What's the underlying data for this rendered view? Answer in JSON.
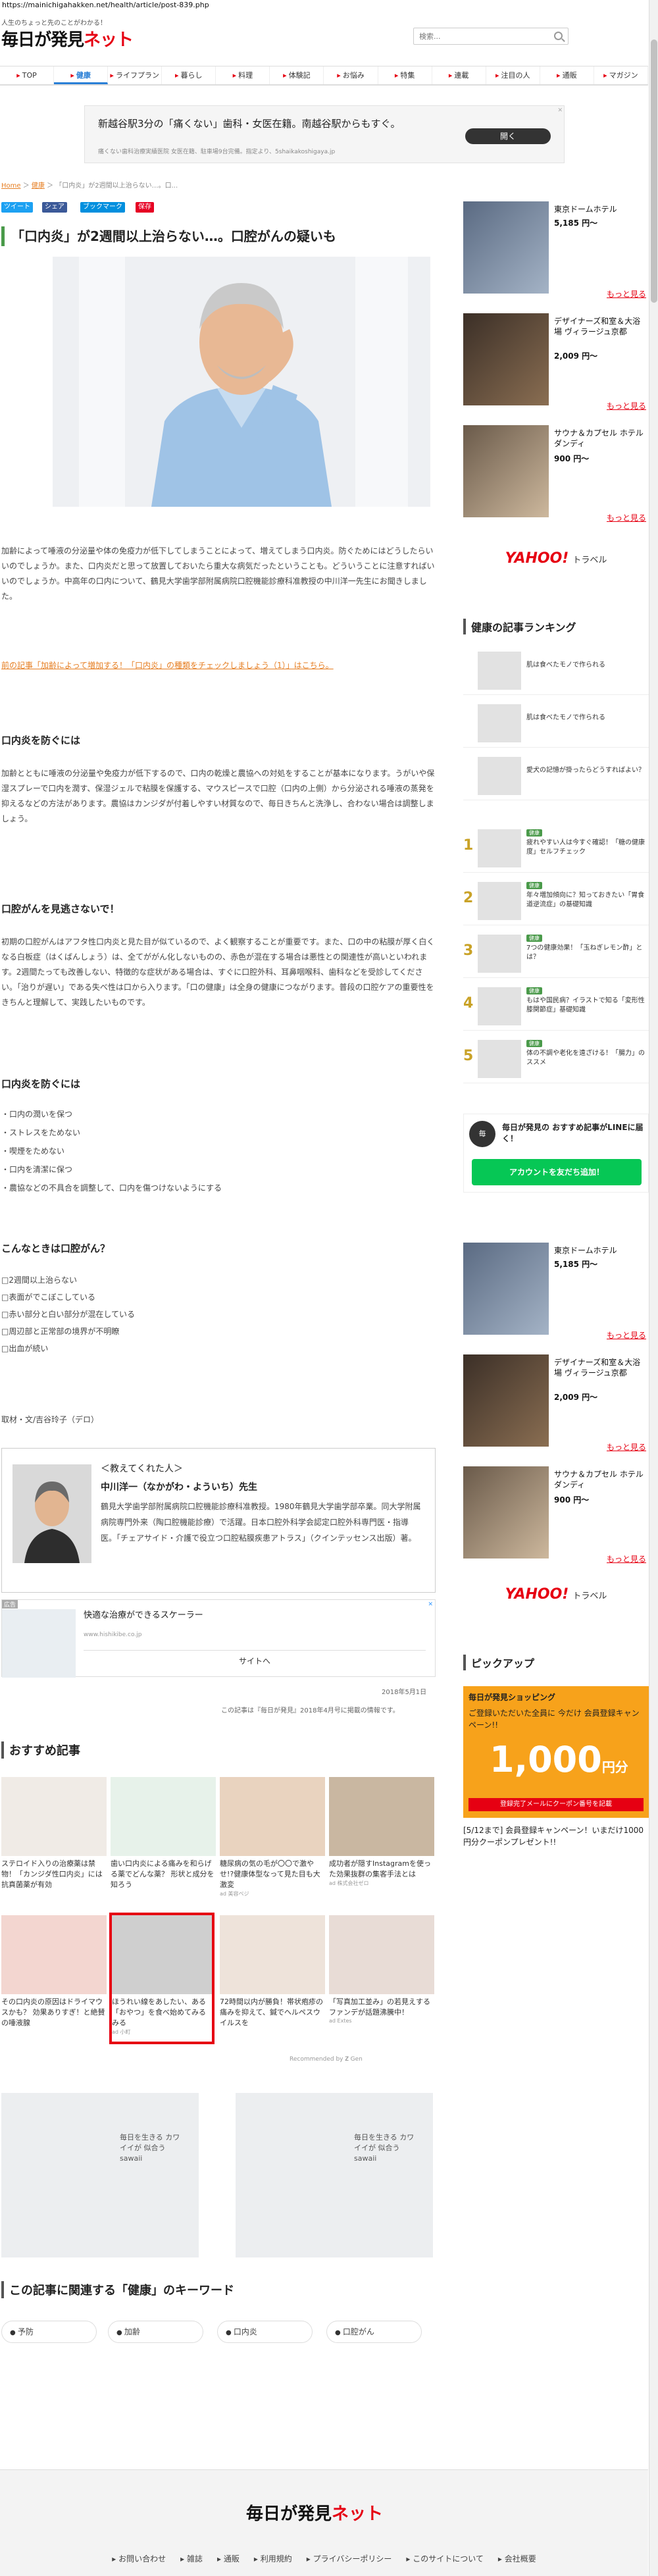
{
  "browser": {
    "url": "https://mainichigahakken.net/health/article/post-839.php"
  },
  "header": {
    "tagline": "人生のちょっと先のことがわかる！",
    "logo_prefix": "毎日が発見",
    "logo_suffix": "ネット",
    "search_placeholder": "検索...",
    "social": [
      {
        "name": "facebook-icon",
        "glyph": "f",
        "color": "#3b5998"
      },
      {
        "name": "twitter-icon",
        "glyph": "t",
        "color": "#1da1f2"
      },
      {
        "name": "rss-icon",
        "glyph": "◉",
        "color": "#3fa0f0"
      }
    ]
  },
  "nav": [
    "TOP",
    "健康",
    "ライフプラン",
    "暮らし",
    "料理",
    "体験記",
    "お悩み",
    "特集",
    "連載",
    "注目の人",
    "通販",
    "マガジン"
  ],
  "ad_top": {
    "line1": "新越谷駅3分の「痛くない」歯科・女医在籍。南越谷駅からもすぐ。",
    "line2": "痛くない歯科治療実績医院 女医在籍、駐車場9台完備。指定より、5shaikakoshigaya.jp",
    "button": "開く",
    "close": "✕"
  },
  "breadcrumb": [
    "Home",
    "健康",
    "「口内炎」が2週間以上治らない…。口..."
  ],
  "share_buttons": [
    {
      "label": "ツイート",
      "color": "#1da1f2"
    },
    {
      "label": "シェア",
      "color": "#3b5998"
    },
    {
      "label": "ブックマーク",
      "color": "#008fde"
    },
    {
      "label": "保存",
      "color": "#e60023"
    }
  ],
  "article": {
    "title": "「口内炎」が2週間以上治らない…。口腔がんの疑いも",
    "intro": "加齢によって唾液の分泌量や体の免疫力が低下してしまうことによって、増えてしまう口内炎。防ぐためにはどうしたらいいのでしょうか。また、口内炎だと思って放置しておいたら重大な病気だったということも。どういうことに注意すればいいのでしょうか。中高年の口内について、鶴見大学歯学部附属病院口腔機能診療科准教授の中川洋一先生にお聞きしました。",
    "prev_link": "前の記事「加齢によって増加する！「口内炎」の種類をチェックしましょう（1）」はこちら。",
    "h_prevent": "口内炎を防ぐには",
    "p_prevent": "加齢とともに唾液の分泌量や免疫力が低下するので、口内の乾燥と農協への対処をすることが基本になります。うがいや保湿スプレーで口内を潤す、保湿ジェルで粘膜を保護する、マウスピースで口腔（口内の上側）から分泌される唾液の蒸発を抑えるなどの方法があります。農協はカンジダが付着しやすい材質なので、毎日きちんと洗浄し、合わない場合は調整しましょう。",
    "h_cancer": "口腔がんを見逃さないで！",
    "p_cancer": "初期の口腔がんはアフタ性口内炎と見た目が似ているので、よく観察することが重要です。また、口の中の粘膜が厚く白くなる白板症（はくばんしょう）は、全てががん化しないものの、赤色が混在する場合は悪性との関連性が高いといわれます。2週間たっても改善しない、特徴的な症状がある場合は、すぐに口腔外科、耳鼻咽喉科、歯科などを受診してください。「治りが遅い」である失べ性は口から入ります。「口の健康」は全身の健康につながります。普段の口腔ケアの重要性をきちんと理解して、実践したいものです。",
    "h_tips": "口内炎を防ぐには",
    "tips": [
      "口内の潤いを保つ",
      "ストレスをためない",
      "喫煙をためない",
      "口内を清潔に保つ",
      "農協などの不具合を調整して、口内を傷つけないようにする"
    ],
    "h_check": "こんなときは口腔がん？",
    "check": [
      "□2週間以上治らない",
      "□表面がでこぼこしている",
      "□赤い部分と白い部分が混在している",
      "□周辺部と正常部の境界が不明瞭",
      "□出血が続い"
    ],
    "credit": "取材・文/吉谷玲子（デロ）",
    "author": {
      "heading": "＜教えてくれた人＞",
      "name": "中川洋一（なかがわ・よういち）先生",
      "bio": "鶴見大学歯学部附属病院口腔機能診療科准教授。1980年鶴見大学歯学部卒業。同大学附属病院専門外来（陶口腔機能診療）で活躍。日本口腔外科学会認定口腔外科専門医・指導医。「チェアサイド・介護で役立つ口腔粘膜疾患アトラス」（クインテッセンス出版）著。"
    },
    "ad_small": {
      "label": "広告",
      "title": "快適な治療ができるスケーラー",
      "domain": "www.hishikibe.co.jp",
      "link": "サイトへ"
    },
    "date": "2018年5月1日",
    "source_note": "この記事は『毎日が発見』2018年4月号に掲載の情報です。"
  },
  "recommend": {
    "heading": "おすすめ記事",
    "items": [
      {
        "caption": "ステロイド入りの治療薬は禁物！「カンジダ性口内炎」には抗真菌薬が有効",
        "source": ""
      },
      {
        "caption": "歯い口内炎による痛みを和らげる薬でどんな薬？ 形状と成分を知ろう",
        "source": ""
      },
      {
        "caption": "糖尿病の気の毛が〇〇で激やせ!?健康体型なって見た目も大激変",
        "source": "ad 美容ベジ"
      },
      {
        "caption": "成功者が隠すInstagramを使った効果抜群の集客手法とは",
        "source": "ad 株式会社ゼロ"
      },
      {
        "caption": "その口内炎の原因はドライマウスかも？ 効果ありすぎ！と絶賛の唾液腺",
        "source": ""
      },
      {
        "caption": "ほうれい線をあしたい、ある「おやつ」を食べ始めてみるみる",
        "source": "ad 小町"
      },
      {
        "caption": "72時間以内が勝負！帯状疱疹の痛みを抑えて、鍼でヘルペスウイルスを",
        "source": ""
      },
      {
        "caption": "「写真加工並み」の若見えするファンデが話題沸騰中！",
        "source": "ad Extes"
      }
    ],
    "recommended_by": "Recommended by 𝐙 Gen"
  },
  "ad_banners": [
    {
      "text": "毎日を生きる カワイイが 似合う sawaii"
    },
    {
      "text": "毎日を生きる カワイイが 似合う sawaii"
    }
  ],
  "keywords": {
    "heading": "この記事に関連する「健康」のキーワード",
    "items": [
      "予防",
      "加齢",
      "口内炎",
      "口腔がん"
    ]
  },
  "sidebar": {
    "hotels_top": [
      {
        "name": "東京ドームホテル",
        "price": "5,185 円〜"
      },
      {
        "name": "デザイナーズ和室＆大浴場 ヴィラージュ京都",
        "price": "2,009 円〜"
      },
      {
        "name": "サウナ＆カプセル ホテル ダンディ",
        "price": "900 円〜"
      }
    ],
    "more": "もっと見る",
    "yahoo": "YAHOO!",
    "yahoo_sub": "トラベル",
    "ranking_heading": "健康の記事ランキング",
    "ranking": [
      {
        "num": "",
        "tag": "",
        "text": "肌は食べたモノで作られる"
      },
      {
        "num": "",
        "tag": "",
        "text": "肌は食べたモノで作られる"
      },
      {
        "num": "",
        "tag": "",
        "text": "愛犬の記憶が掛ったらどうすればよい？"
      },
      {
        "num": "1",
        "tag": "健康",
        "text": "疲れやすい人は今すぐ確認！「糖の健康度」セルフチェック"
      },
      {
        "num": "2",
        "tag": "健康",
        "text": "年々増加傾向に？知っておきたい「胃食道逆流症」の基礎知識"
      },
      {
        "num": "3",
        "tag": "健康",
        "text": "7つの健康効果！「玉ねぎレモン酢」とは？"
      },
      {
        "num": "4",
        "tag": "健康",
        "text": "もはや国民病？イラストで知る「変形性膝関節症」基礎知識"
      },
      {
        "num": "5",
        "tag": "健康",
        "text": "体の不調や老化を遠ざける！「腸力」のススメ"
      }
    ],
    "line_title": "毎日が発見の おすすめ記事がLINEに届く！",
    "line_button": "アカウントを友だち追加！",
    "hotels_bottom": [
      {
        "name": "東京ドームホテル",
        "price": "5,185 円〜"
      },
      {
        "name": "デザイナーズ和室＆大浴場 ヴィラージュ京都",
        "price": "2,009 円〜"
      },
      {
        "name": "サウナ＆カプセル ホテル ダンディ",
        "price": "900 円〜"
      }
    ],
    "pickup_heading": "ピックアップ",
    "pickup_banner_title": "毎日が発見ショッピング",
    "pickup_banner_sub": "ご登録いただいた全員に 今だけ 会員登録キャンペーン!!",
    "pickup_banner_amount": "1,000",
    "pickup_banner_unit": "円分",
    "pickup_banner_note": "登録完了メールにクーポン番号を記載",
    "pickup_caption": "[5/12まで] 会員登録キャンペーン！いまだけ1000円分クーポンプレゼント!!"
  },
  "footer": {
    "logo_prefix": "毎日が発見",
    "logo_suffix": "ネット",
    "links": [
      "お問い合わせ",
      "雑誌",
      "通販",
      "利用規約",
      "プライバシーポリシー",
      "このサイトについて",
      "会社概要"
    ]
  }
}
